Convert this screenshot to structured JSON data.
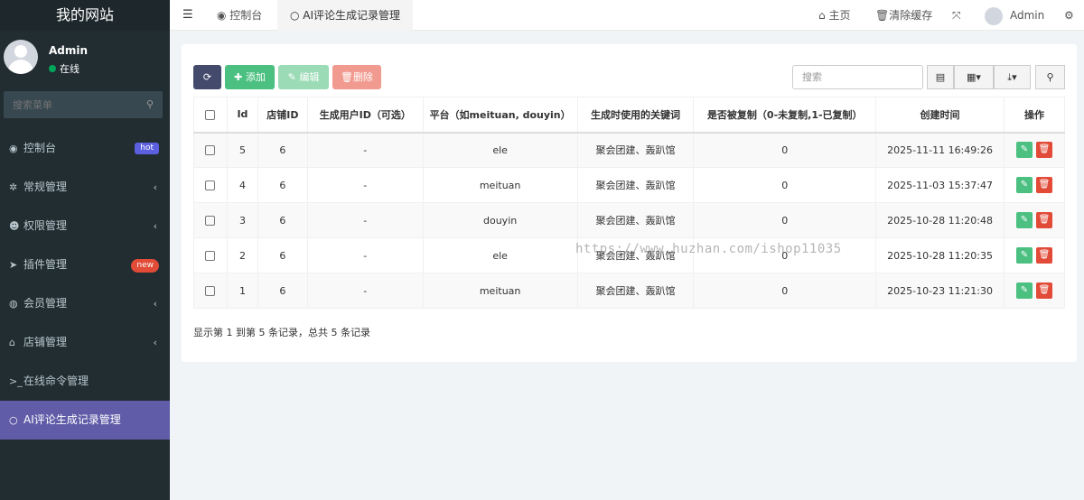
{
  "site_title": "我的网站",
  "user": {
    "name": "Admin",
    "status": "在线"
  },
  "sidebar_search_placeholder": "搜索菜单",
  "menu": [
    {
      "icon": "dashboard-icon",
      "glyph": "◉",
      "label": "控制台",
      "badge": "hot",
      "chevron": false
    },
    {
      "icon": "cogs-icon",
      "glyph": "✲",
      "label": "常规管理",
      "badge": "",
      "chevron": true
    },
    {
      "icon": "users-icon",
      "glyph": "☻",
      "label": "权限管理",
      "badge": "",
      "chevron": true
    },
    {
      "icon": "rocket-icon",
      "glyph": "➤",
      "label": "插件管理",
      "badge": "new",
      "chevron": false
    },
    {
      "icon": "user-circle-icon",
      "glyph": "◍",
      "label": "会员管理",
      "badge": "",
      "chevron": true
    },
    {
      "icon": "home-icon",
      "glyph": "⌂",
      "label": "店铺管理",
      "badge": "",
      "chevron": true
    },
    {
      "icon": "terminal-icon",
      "glyph": ">_",
      "label": "在线命令管理",
      "badge": "",
      "chevron": false
    },
    {
      "icon": "circle-icon",
      "glyph": "○",
      "label": "AI评论生成记录管理",
      "badge": "",
      "chevron": false,
      "active": true
    }
  ],
  "topbar": {
    "tabs": [
      {
        "label": "控制台",
        "glyph": "◉"
      },
      {
        "label": "AI评论生成记录管理",
        "glyph": "○"
      }
    ],
    "home": "主页",
    "clear_cache": "清除缓存",
    "admin": "Admin"
  },
  "toolbar": {
    "add": "添加",
    "edit": "编辑",
    "delete": "删除",
    "search_placeholder": "搜索"
  },
  "table": {
    "headers": [
      "Id",
      "店铺ID",
      "生成用户ID（可选）",
      "平台（如meituan, douyin）",
      "生成时使用的关键词",
      "是否被复制（0-未复制,1-已复制）",
      "创建时间",
      "操作"
    ],
    "rows": [
      [
        "5",
        "6",
        "-",
        "ele",
        "聚会团建、轰趴馆",
        "0",
        "2025-11-11 16:49:26"
      ],
      [
        "4",
        "6",
        "-",
        "meituan",
        "聚会团建、轰趴馆",
        "0",
        "2025-11-03 15:37:47"
      ],
      [
        "3",
        "6",
        "-",
        "douyin",
        "聚会团建、轰趴馆",
        "0",
        "2025-10-28 11:20:48"
      ],
      [
        "2",
        "6",
        "-",
        "ele",
        "聚会团建、轰趴馆",
        "0",
        "2025-10-28 11:20:35"
      ],
      [
        "1",
        "6",
        "-",
        "meituan",
        "聚会团建、轰趴馆",
        "0",
        "2025-10-23 11:21:30"
      ]
    ]
  },
  "pagination_info": "显示第 1 到第 5 条记录，总共 5 条记录",
  "watermark": "https://www.huzhan.com/ishop11035",
  "colors": {
    "sidebar": "#222d32",
    "active": "#605ca8",
    "add": "#4bc081",
    "delete": "#e14b38"
  }
}
